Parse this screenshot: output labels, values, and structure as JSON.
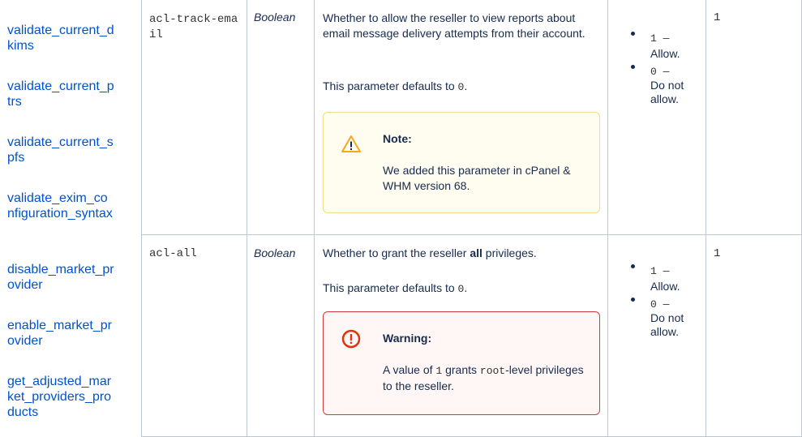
{
  "sidebar": {
    "links": [
      "validate_current_dkims",
      "validate_current_ptrs",
      "validate_current_spfs",
      "validate_exim_configuration_syntax",
      "disable_market_provider",
      "enable_market_provider",
      "get_adjusted_market_providers_products"
    ]
  },
  "rows": [
    {
      "parameter": "acl-track-email",
      "type": "Boolean",
      "description": "Whether to allow the reseller to view reports about email message delivery attempts from their account.",
      "default_prefix": "This parameter defaults to",
      "default_value": "0",
      "default_suffix": ".",
      "panel": {
        "kind": "note",
        "title": "Note:",
        "body": "We added this parameter in cPanel & WHM version 68."
      },
      "values": [
        {
          "code": "1",
          "dash": "—",
          "label": "Allow."
        },
        {
          "code": "0",
          "dash": "—",
          "label": "Do not allow."
        }
      ],
      "example": "1"
    },
    {
      "parameter": "acl-all",
      "type": "Boolean",
      "description_pre": "Whether to grant the reseller",
      "description_bold": "all",
      "description_post": "privileges.",
      "default_prefix": "This parameter defaults to",
      "default_value": "0",
      "default_suffix": ".",
      "panel": {
        "kind": "warning",
        "title": "Warning:",
        "body_pre": "A value of",
        "body_code1": "1",
        "body_mid": "grants",
        "body_code2": "root",
        "body_post": "-level privileges to the reseller."
      },
      "values": [
        {
          "code": "1",
          "dash": "—",
          "label": "Allow."
        },
        {
          "code": "0",
          "dash": "—",
          "label": "Do not allow."
        }
      ],
      "example": "1"
    }
  ],
  "colors": {
    "link": "#0052cc",
    "border": "#c1c7d0",
    "note_bg": "#fffdf0",
    "note_border": "#f2dc8a",
    "warn_bg": "#fff6f6",
    "warn_border": "#cf3a3a",
    "warn_icon": "#de350b",
    "note_icon": "#f5a623"
  }
}
